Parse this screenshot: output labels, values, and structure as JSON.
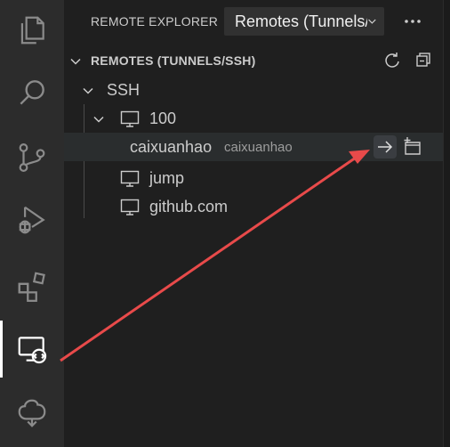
{
  "app": {
    "panel_title": "REMOTE EXPLORER",
    "selector_value": "Remotes (Tunnels/SSH)"
  },
  "activity_bar": {
    "items": [
      "explorer",
      "search",
      "source-control",
      "run-debug",
      "extensions",
      "remote-explorer",
      "remote-tunnel"
    ]
  },
  "section": {
    "title": "REMOTES (TUNNELS/SSH)"
  },
  "tree": {
    "root": "SSH",
    "host_100": "100",
    "child_label": "caixuanhao",
    "child_desc": "caixuanhao",
    "host_jump": "jump",
    "host_github": "github.com"
  },
  "colors": {
    "accent": "#ffffff",
    "annotation_arrow": "#e84a4a"
  }
}
